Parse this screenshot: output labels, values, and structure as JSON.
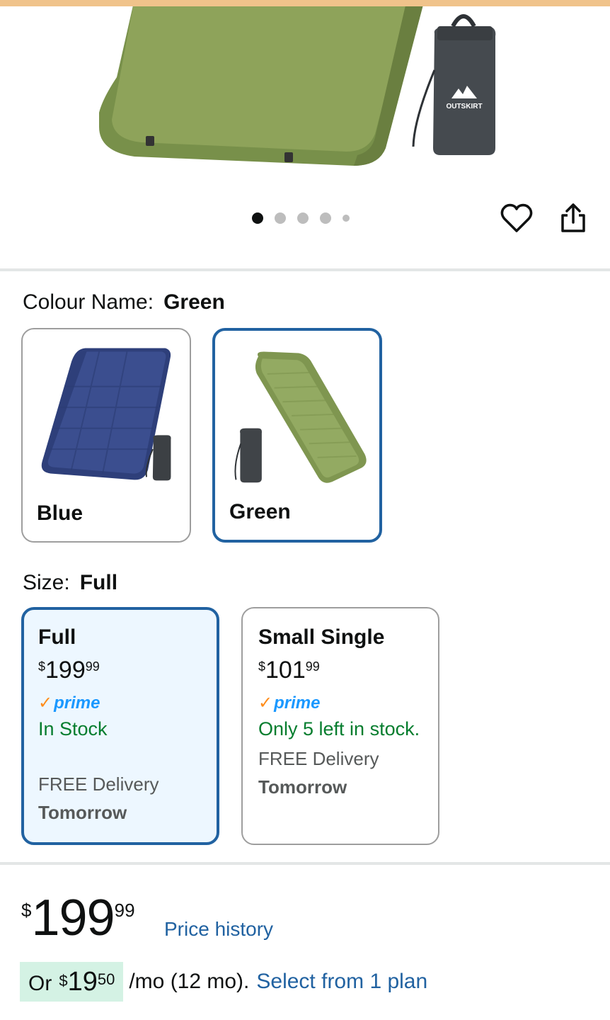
{
  "colors": {
    "accent": "#2162a1",
    "stock_green": "#067d2e",
    "prime_blue": "#1a98ff",
    "emi_bg": "#d4f2e4"
  },
  "gallery": {
    "brand_text": "OUTSKIRT",
    "dot_count": 5,
    "active_dot": 0
  },
  "actions": {
    "wishlist_icon": "heart-icon",
    "share_icon": "share-icon"
  },
  "colour": {
    "label": "Colour Name:",
    "selected": "Green",
    "options": [
      {
        "name": "Blue",
        "selected": false
      },
      {
        "name": "Green",
        "selected": true
      }
    ]
  },
  "size": {
    "label": "Size:",
    "selected": "Full",
    "options": [
      {
        "name": "Full",
        "currency": "$",
        "whole": "199",
        "cents": "99",
        "prime": "prime",
        "stock": "In Stock",
        "delivery": "FREE Delivery",
        "when": "Tomorrow",
        "selected": true
      },
      {
        "name": "Small Single",
        "currency": "$",
        "whole": "101",
        "cents": "99",
        "prime": "prime",
        "stock": "Only 5 left in stock.",
        "delivery": "FREE Delivery",
        "when": "Tomorrow",
        "selected": false
      }
    ]
  },
  "price": {
    "currency": "$",
    "whole": "199",
    "cents": "99",
    "history_link": "Price history"
  },
  "emi": {
    "or": "Or",
    "currency": "$",
    "whole": "19",
    "cents": "50",
    "term": "/mo (12 mo).",
    "link": "Select from 1 plan"
  }
}
